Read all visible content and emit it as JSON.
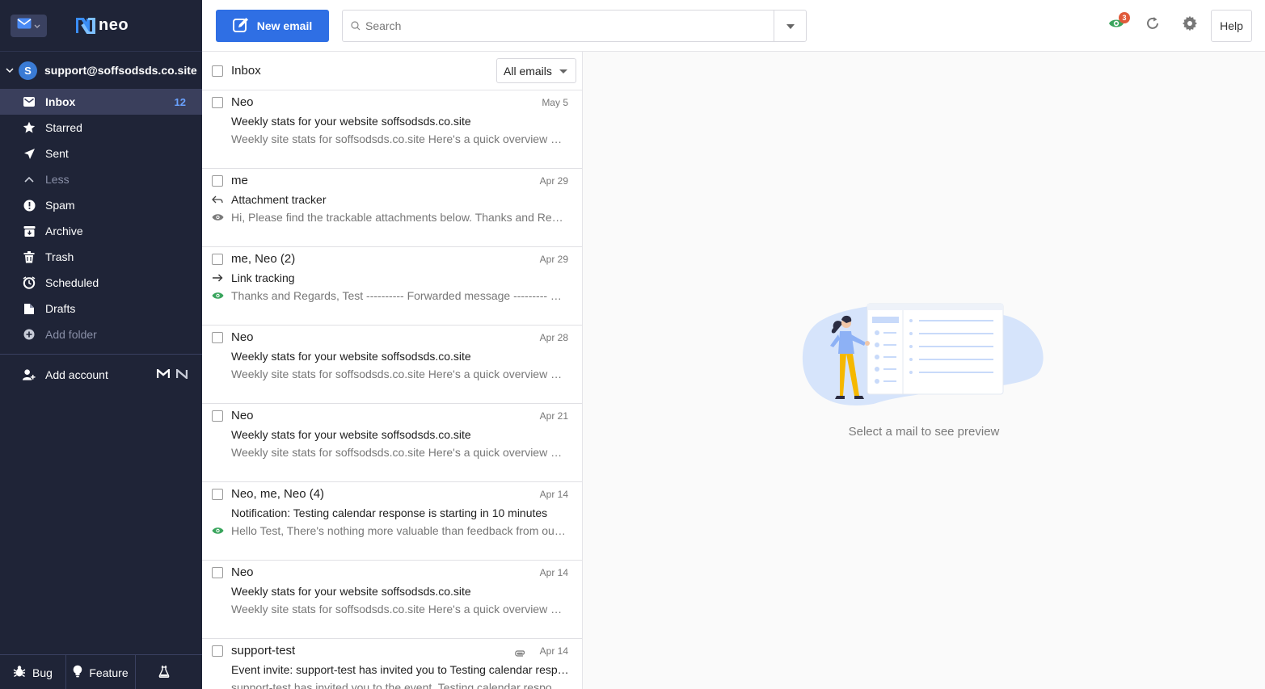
{
  "colors": {
    "sidebar_bg": "#1f2437",
    "accent": "#2f6fe4",
    "unread_count": "#6aa2ff",
    "tracked_green": "#3aa55d"
  },
  "brand": {
    "name": "neo"
  },
  "account": {
    "initial": "S",
    "email": "support@soffsodsds.co.site"
  },
  "sidebar": {
    "items": [
      {
        "label": "Inbox",
        "icon": "inbox-icon",
        "count": "12"
      },
      {
        "label": "Starred",
        "icon": "star-icon"
      },
      {
        "label": "Sent",
        "icon": "send-icon"
      },
      {
        "label": "Less",
        "icon": "chevron-up-icon"
      },
      {
        "label": "Spam",
        "icon": "spam-icon"
      },
      {
        "label": "Archive",
        "icon": "archive-icon"
      },
      {
        "label": "Trash",
        "icon": "trash-icon"
      },
      {
        "label": "Scheduled",
        "icon": "scheduled-icon"
      },
      {
        "label": "Drafts",
        "icon": "drafts-icon"
      },
      {
        "label": "Add folder",
        "icon": "plus-circle-icon"
      }
    ],
    "add_account": "Add account",
    "bottom": {
      "bug": "Bug",
      "feature": "Feature"
    }
  },
  "toolbar": {
    "new_email": "New email",
    "search_placeholder": "Search",
    "notification_count": "3",
    "help": "Help"
  },
  "list": {
    "title": "Inbox",
    "filter": "All emails",
    "emails": [
      {
        "from": "Neo",
        "date": "May 5",
        "subject": "Weekly stats for your website soffsodsds.co.site",
        "preview": "Weekly site stats for soffsodsds.co.site Here's a quick overview of your site's performance this week",
        "icon1": "",
        "icon2": ""
      },
      {
        "from": "me",
        "date": "Apr 29",
        "subject": "Attachment tracker",
        "preview": "Hi, Please find the trackable attachments below. Thanks and Regards, Test",
        "icon1": "reply",
        "icon2": "eye-gray"
      },
      {
        "from": "me, Neo (2)",
        "date": "Apr 29",
        "subject": "Link tracking",
        "preview": "Thanks and Regards, Test ---------- Forwarded message --------- From: Neo",
        "icon1": "forward",
        "icon2": "eye-green"
      },
      {
        "from": "Neo",
        "date": "Apr 28",
        "subject": "Weekly stats for your website soffsodsds.co.site",
        "preview": "Weekly site stats for soffsodsds.co.site Here's a quick overview of your site's performance this week",
        "icon1": "",
        "icon2": ""
      },
      {
        "from": "Neo",
        "date": "Apr 21",
        "subject": "Weekly stats for your website soffsodsds.co.site",
        "preview": "Weekly site stats for soffsodsds.co.site Here's a quick overview of your site's performance this week",
        "icon1": "",
        "icon2": ""
      },
      {
        "from": "Neo, me, Neo (4)",
        "date": "Apr 14",
        "subject": "Notification: Testing calendar response is starting in 10 minutes",
        "preview": "Hello Test, There's nothing more valuable than feedback from our customers",
        "icon1": "",
        "icon2": "eye-green"
      },
      {
        "from": "Neo",
        "date": "Apr 14",
        "subject": "Weekly stats for your website soffsodsds.co.site",
        "preview": "Weekly site stats for soffsodsds.co.site Here's a quick overview of your site's performance this week",
        "icon1": "",
        "icon2": ""
      },
      {
        "from": "support-test",
        "date": "Apr 14",
        "subject": "Event invite: support-test has invited you to Testing calendar response",
        "preview": "support-test has invited you to the event. Testing calendar response",
        "icon1": "",
        "icon2": "",
        "attachment": true
      }
    ]
  },
  "preview": {
    "empty_text": "Select a mail to see preview"
  }
}
